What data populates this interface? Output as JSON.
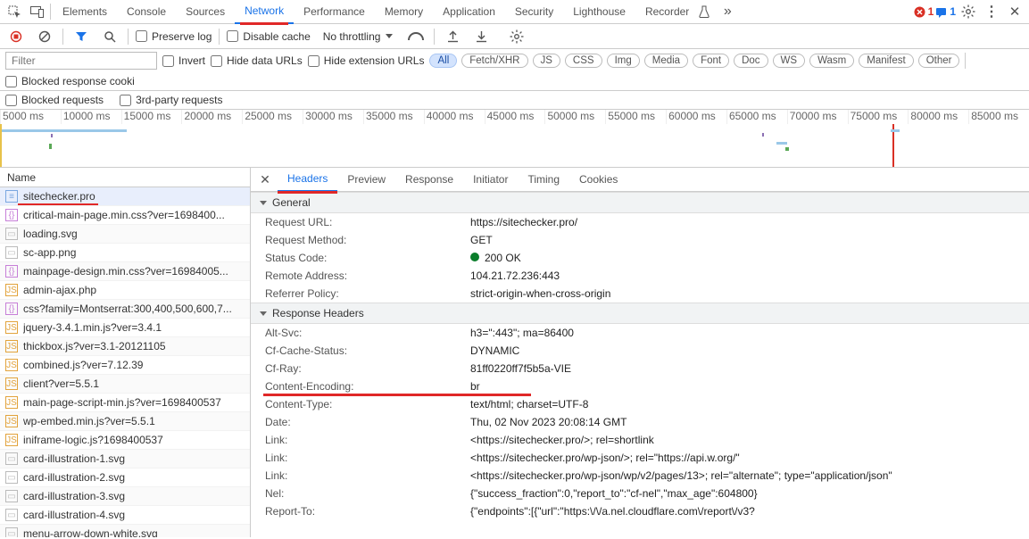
{
  "topTabs": [
    "Elements",
    "Console",
    "Sources",
    "Network",
    "Performance",
    "Memory",
    "Application",
    "Security",
    "Lighthouse",
    "Recorder"
  ],
  "activeTopTab": "Network",
  "errBadge": "1",
  "msgBadge": "1",
  "toolbar2": {
    "preserveLog": "Preserve log",
    "disableCache": "Disable cache",
    "throttle": "No throttling"
  },
  "filter": {
    "placeholder": "Filter",
    "invert": "Invert",
    "hideData": "Hide data URLs",
    "hideExt": "Hide extension URLs",
    "pills": [
      "All",
      "Fetch/XHR",
      "JS",
      "CSS",
      "Img",
      "Media",
      "Font",
      "Doc",
      "WS",
      "Wasm",
      "Manifest",
      "Other"
    ],
    "blockedCookies": "Blocked response cooki",
    "blockedReq": "Blocked requests",
    "thirdParty": "3rd-party requests"
  },
  "timelineTicks": [
    "5000 ms",
    "10000 ms",
    "15000 ms",
    "20000 ms",
    "25000 ms",
    "30000 ms",
    "35000 ms",
    "40000 ms",
    "45000 ms",
    "50000 ms",
    "55000 ms",
    "60000 ms",
    "65000 ms",
    "70000 ms",
    "75000 ms",
    "80000 ms",
    "85000 ms"
  ],
  "listHeader": "Name",
  "requests": [
    {
      "icon": "doc",
      "name": "sitechecker.pro",
      "selected": true
    },
    {
      "icon": "css",
      "name": "critical-main-page.min.css?ver=1698400..."
    },
    {
      "icon": "img",
      "name": "loading.svg"
    },
    {
      "icon": "img",
      "name": "sc-app.png"
    },
    {
      "icon": "css",
      "name": "mainpage-design.min.css?ver=16984005..."
    },
    {
      "icon": "js",
      "name": "admin-ajax.php"
    },
    {
      "icon": "css",
      "name": "css?family=Montserrat:300,400,500,600,7..."
    },
    {
      "icon": "js",
      "name": "jquery-3.4.1.min.js?ver=3.4.1"
    },
    {
      "icon": "js",
      "name": "thickbox.js?ver=3.1-20121105"
    },
    {
      "icon": "js",
      "name": "combined.js?ver=7.12.39"
    },
    {
      "icon": "js",
      "name": "client?ver=5.5.1"
    },
    {
      "icon": "js",
      "name": "main-page-script-min.js?ver=1698400537"
    },
    {
      "icon": "js",
      "name": "wp-embed.min.js?ver=5.5.1"
    },
    {
      "icon": "js",
      "name": "iniframe-logic.js?1698400537"
    },
    {
      "icon": "img",
      "name": "card-illustration-1.svg"
    },
    {
      "icon": "img",
      "name": "card-illustration-2.svg"
    },
    {
      "icon": "img",
      "name": "card-illustration-3.svg"
    },
    {
      "icon": "img",
      "name": "card-illustration-4.svg"
    },
    {
      "icon": "img",
      "name": "menu-arrow-down-white.svg"
    }
  ],
  "detailTabs": [
    "Headers",
    "Preview",
    "Response",
    "Initiator",
    "Timing",
    "Cookies"
  ],
  "activeDetailTab": "Headers",
  "sections": {
    "general": {
      "title": "General",
      "rows": [
        {
          "k": "Request URL:",
          "v": "https://sitechecker.pro/"
        },
        {
          "k": "Request Method:",
          "v": "GET"
        },
        {
          "k": "Status Code:",
          "v": "200 OK",
          "status": true
        },
        {
          "k": "Remote Address:",
          "v": "104.21.72.236:443"
        },
        {
          "k": "Referrer Policy:",
          "v": "strict-origin-when-cross-origin"
        }
      ]
    },
    "response": {
      "title": "Response Headers",
      "rows": [
        {
          "k": "Alt-Svc:",
          "v": "h3=\":443\"; ma=86400"
        },
        {
          "k": "Cf-Cache-Status:",
          "v": "DYNAMIC"
        },
        {
          "k": "Cf-Ray:",
          "v": "81ff0220ff7f5b5a-VIE"
        },
        {
          "k": "Content-Encoding:",
          "v": "br",
          "redUnder": true
        },
        {
          "k": "Content-Type:",
          "v": "text/html; charset=UTF-8"
        },
        {
          "k": "Date:",
          "v": "Thu, 02 Nov 2023 20:08:14 GMT"
        },
        {
          "k": "Link:",
          "v": "<https://sitechecker.pro/>; rel=shortlink"
        },
        {
          "k": "Link:",
          "v": "<https://sitechecker.pro/wp-json/>; rel=\"https://api.w.org/\""
        },
        {
          "k": "Link:",
          "v": "<https://sitechecker.pro/wp-json/wp/v2/pages/13>; rel=\"alternate\"; type=\"application/json\""
        },
        {
          "k": "Nel:",
          "v": "{\"success_fraction\":0,\"report_to\":\"cf-nel\",\"max_age\":604800}"
        },
        {
          "k": "Report-To:",
          "v": "{\"endpoints\":[{\"url\":\"https:\\/\\/a.nel.cloudflare.com\\/report\\/v3?"
        }
      ]
    }
  }
}
